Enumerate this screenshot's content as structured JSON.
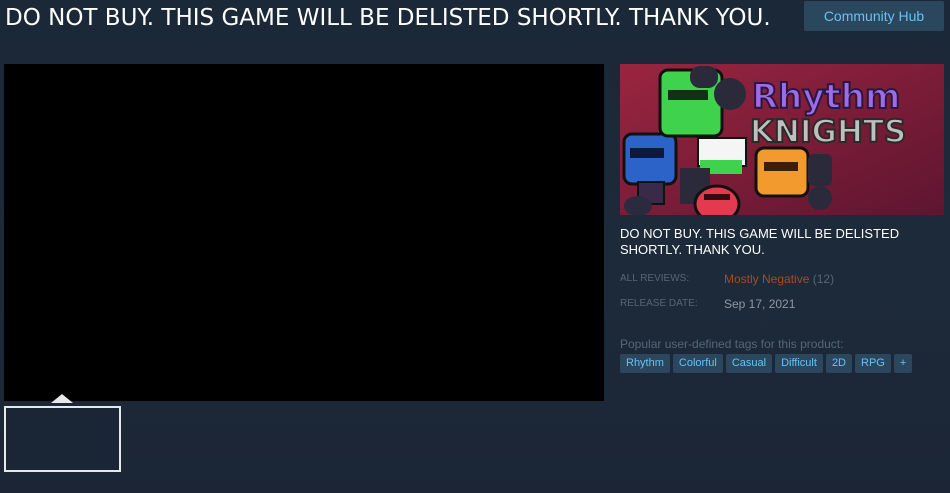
{
  "header": {
    "title": "DO NOT BUY. THIS GAME WILL BE DELISTED SHORTLY. THANK YOU.",
    "community_hub_label": "Community Hub"
  },
  "capsule": {
    "logo_text_line1": "Rhythm",
    "logo_text_line2": "KNIGHTS"
  },
  "description": "DO NOT BUY. THIS GAME WILL BE DELISTED SHORTLY. THANK YOU.",
  "reviews": {
    "label": "ALL REVIEWS:",
    "summary": "Mostly Negative",
    "count": "(12)"
  },
  "release": {
    "label": "RELEASE DATE:",
    "date": "Sep 17, 2021"
  },
  "tags": {
    "label": "Popular user-defined tags for this product:",
    "items": [
      "Rhythm",
      "Colorful",
      "Casual",
      "Difficult",
      "2D",
      "RPG",
      "+"
    ]
  },
  "colors": {
    "background": "#1b2838",
    "accent": "#67c1f5",
    "negative_review": "#a34c25"
  }
}
